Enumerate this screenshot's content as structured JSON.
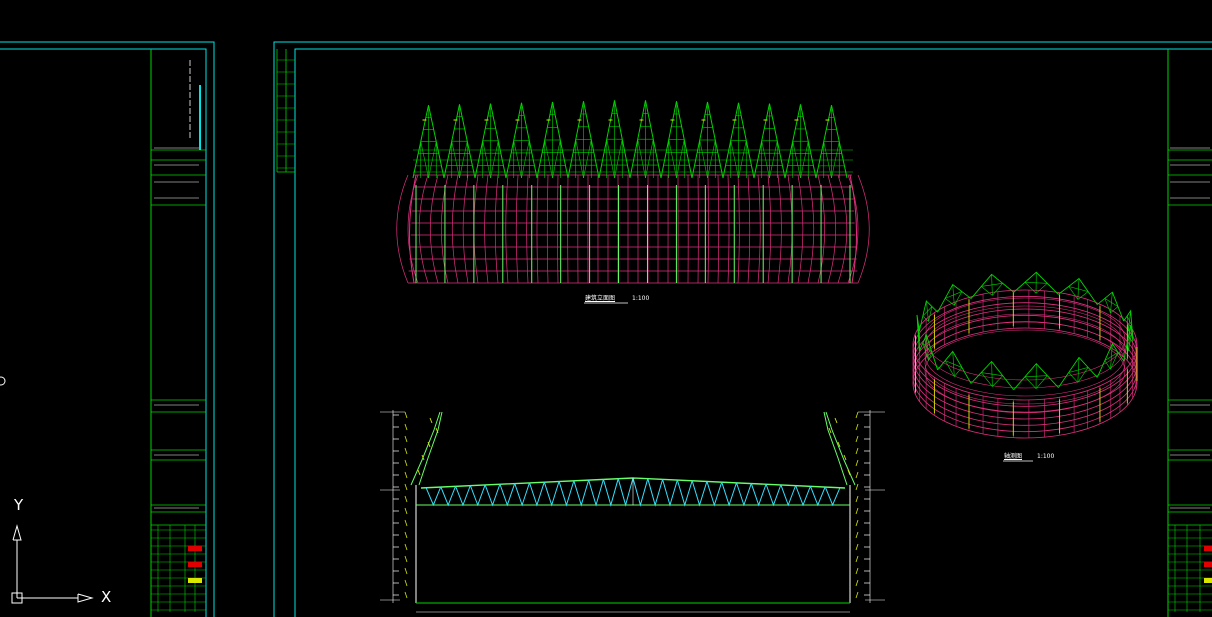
{
  "views": {
    "front_elevation": {
      "title": "建筑立面图",
      "scale": "1:100"
    },
    "axonometric": {
      "title": "轴测图",
      "scale": "1:100"
    }
  },
  "ucs": {
    "x_label": "X",
    "y_label": "Y"
  },
  "colors": {
    "background": "#000000",
    "frame": "#00e5e5",
    "green": "#00d400",
    "light_green": "#66ff66",
    "magenta": "#e0307f",
    "cyan": "#33e0ff",
    "yellow": "#d9e600",
    "white": "#ffffff",
    "red": "#e00000"
  }
}
